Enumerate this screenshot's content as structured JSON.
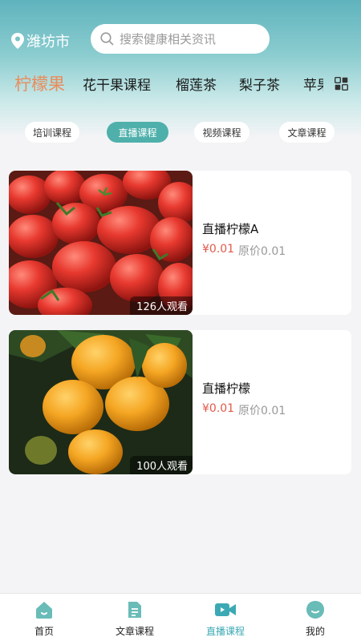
{
  "location": {
    "city": "潍坊市",
    "icon": "location-pin-icon"
  },
  "search": {
    "placeholder": "搜索健康相关资讯",
    "icon": "search-icon"
  },
  "categories": {
    "items": [
      "柠檬果",
      "花干果课程",
      "榴莲茶",
      "梨子茶"
    ],
    "clipped": "苹果",
    "active": "柠檬果",
    "grid_icon": "grid-icon"
  },
  "filters": {
    "items": [
      "培训课程",
      "直播课程",
      "视频课程",
      "文章课程"
    ],
    "active": "直播课程"
  },
  "courses": [
    {
      "title": "直播柠檬A",
      "price": "¥0.01",
      "original": "原价0.01",
      "viewers": "126人观看",
      "image": "tomato-photo"
    },
    {
      "title": "直播柠檬",
      "price": "¥0.01",
      "original": "原价0.01",
      "viewers": "100人观看",
      "image": "orange-photo"
    }
  ],
  "tabbar": {
    "items": [
      "首页",
      "文章课程",
      "直播课程",
      "我的"
    ],
    "active": "直播课程"
  },
  "colors": {
    "accent": "#3ba9b4",
    "active_category": "#e98c5c",
    "price": "#e05a4b",
    "pill_active": "#4fb0ab"
  }
}
